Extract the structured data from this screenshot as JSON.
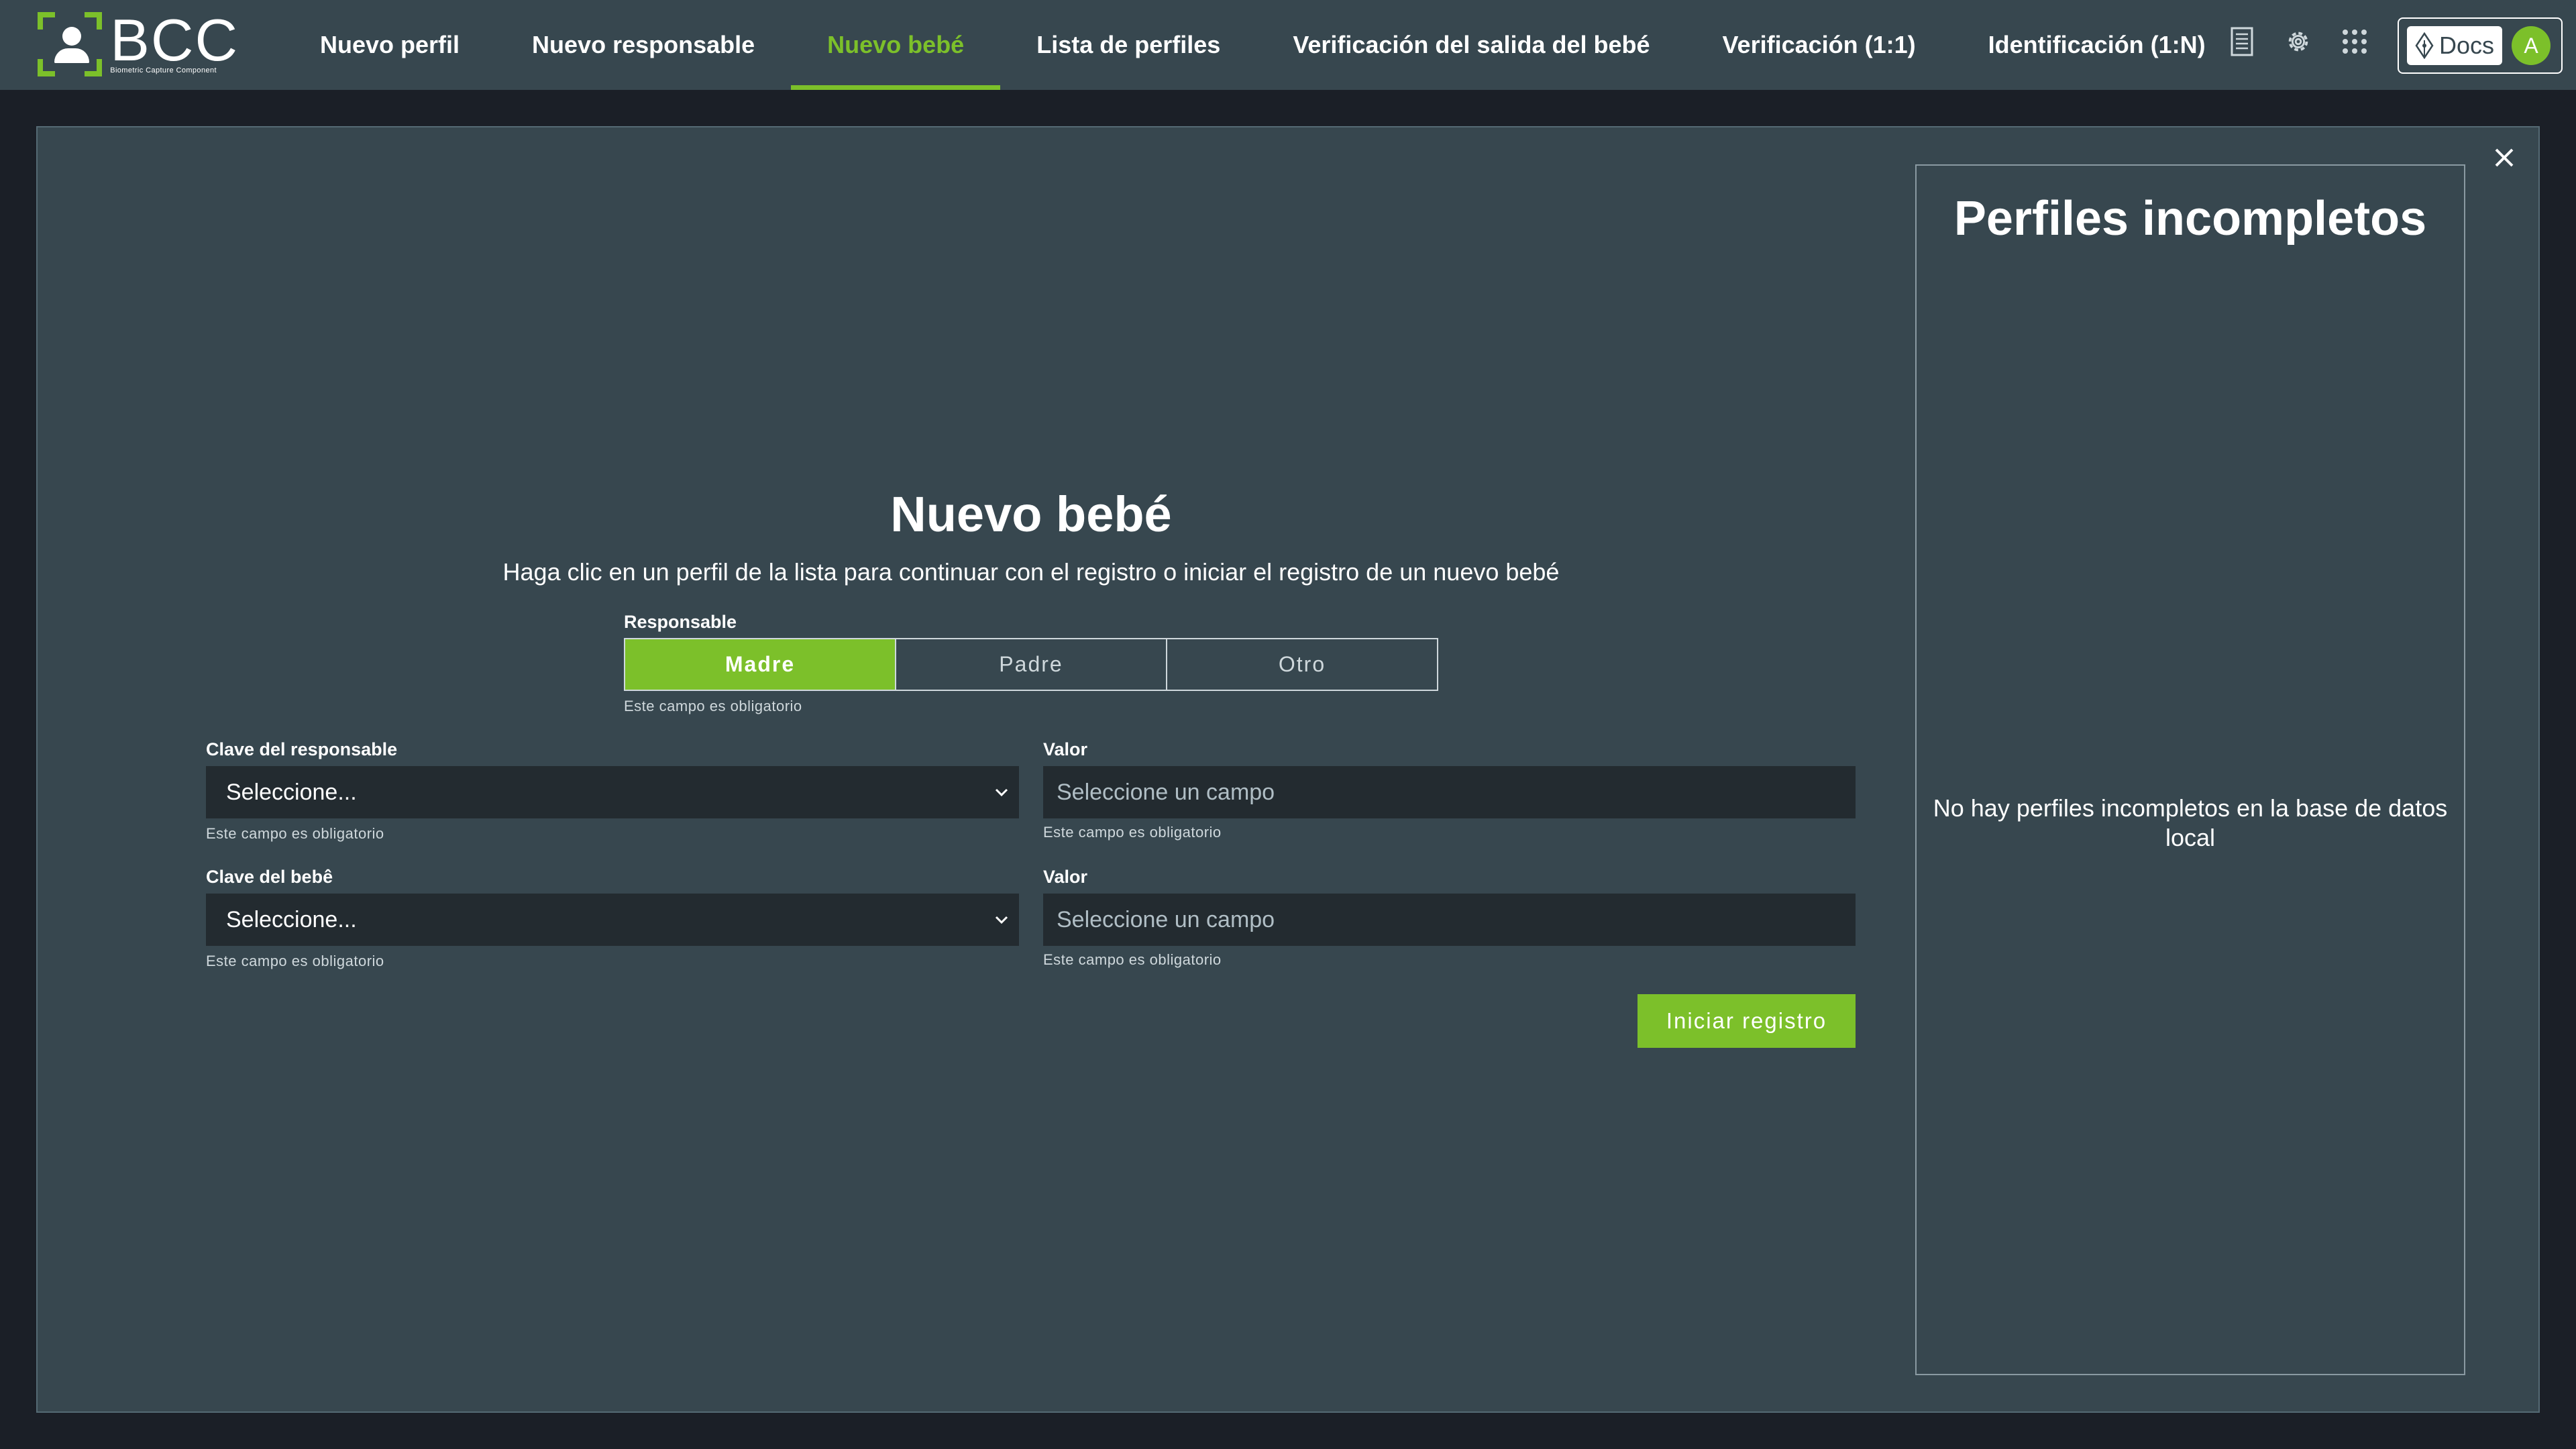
{
  "app": {
    "logo_text": "BCC",
    "logo_subtitle": "Biometric Capture Component"
  },
  "nav": {
    "items": [
      {
        "label": "Nuevo perfil",
        "active": false
      },
      {
        "label": "Nuevo responsable",
        "active": false
      },
      {
        "label": "Nuevo bebé",
        "active": true
      },
      {
        "label": "Lista de perfiles",
        "active": false
      },
      {
        "label": "Verificación del salida del bebé",
        "active": false
      },
      {
        "label": "Verificación (1:1)",
        "active": false
      },
      {
        "label": "Identificación (1:N)",
        "active": false
      }
    ]
  },
  "toolbar": {
    "icons": [
      "document-icon",
      "gear-icon",
      "apps-grid-icon"
    ],
    "docs_label": "Docs",
    "avatar_initial": "A"
  },
  "colors": {
    "accent": "#7cc02a",
    "panel": "#37474f",
    "background": "#1b1f27",
    "field": "#232b30"
  },
  "form": {
    "title": "Nuevo bebé",
    "subtitle": "Haga clic en un perfil de la lista para continuar con el registro o iniciar el registro de un nuevo bebé",
    "responsable": {
      "label": "Responsable",
      "options": [
        "Madre",
        "Padre",
        "Otro"
      ],
      "selected": "Madre",
      "hint": "Este campo es obligatorio"
    },
    "clave_responsable": {
      "label": "Clave del responsable",
      "value": "Seleccione...",
      "hint": "Este campo es obligatorio"
    },
    "valor_responsable": {
      "label": "Valor",
      "placeholder": "Seleccione un campo",
      "hint": "Este campo es obligatorio"
    },
    "clave_bebe": {
      "label": "Clave del bebê",
      "value": "Seleccione...",
      "hint": "Este campo es obligatorio"
    },
    "valor_bebe": {
      "label": "Valor",
      "placeholder": "Seleccione un campo",
      "hint": "Este campo es obligatorio"
    },
    "submit_label": "Iniciar registro"
  },
  "incomplete_profiles": {
    "title": "Perfiles incompletos",
    "empty_message": "No hay perfiles incompletos en la base de datos local"
  }
}
